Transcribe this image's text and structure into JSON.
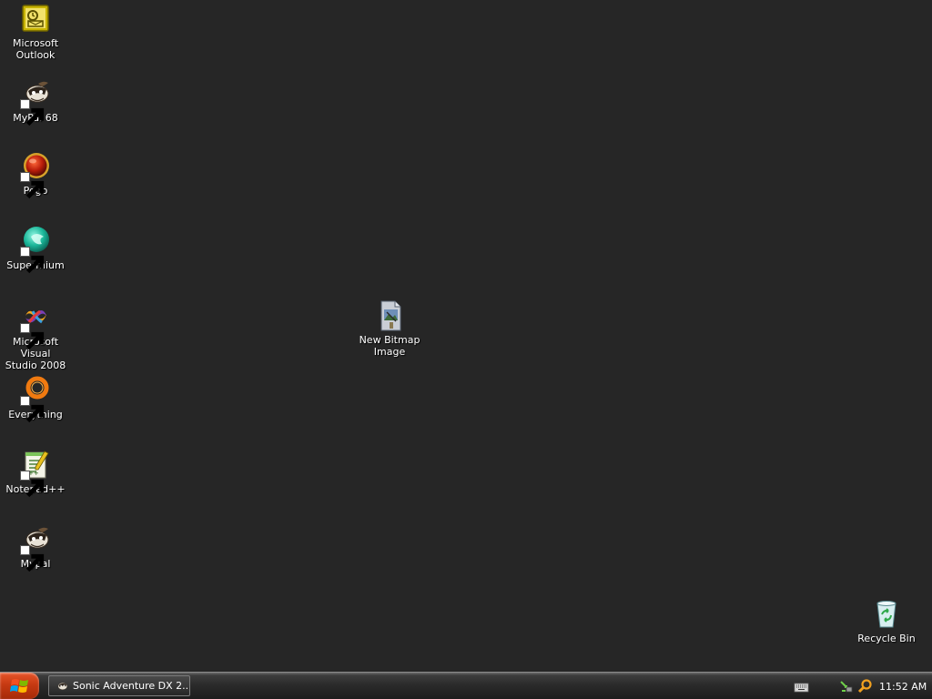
{
  "desktop": {
    "background_color": "#262626",
    "icons": [
      {
        "label": "Microsoft\nOutlook",
        "icon": "outlook-icon",
        "shortcut": false
      },
      {
        "label": "MyPal 68",
        "icon": "mypal-raccoon-icon",
        "shortcut": true
      },
      {
        "label": "Pego",
        "icon": "pego-icon",
        "shortcut": true
      },
      {
        "label": "Supermium",
        "icon": "supermium-icon",
        "shortcut": true
      },
      {
        "label": "Microsoft Visual\nStudio 2008",
        "icon": "visual-studio-icon",
        "shortcut": true
      },
      {
        "label": "Everything",
        "icon": "everything-icon",
        "shortcut": true
      },
      {
        "label": "Notepad++",
        "icon": "notepad-plus-plus-icon",
        "shortcut": true
      },
      {
        "label": "Mypal",
        "icon": "mypal-raccoon-icon",
        "shortcut": true
      },
      {
        "label": "New Bitmap\nImage",
        "icon": "bitmap-file-icon",
        "shortcut": false
      },
      {
        "label": "Recycle Bin",
        "icon": "recycle-bin-icon",
        "shortcut": false
      }
    ]
  },
  "taskbar": {
    "start_button": {
      "icon": "windows-logo-icon",
      "color": "#c63a12"
    },
    "task_button": {
      "label": "Sonic Adventure DX 2...",
      "icon": "mypal-raccoon-icon"
    },
    "language_bar": {
      "icon": "keyboard-icon"
    },
    "tray": {
      "icons": [
        "network-icon",
        "search-icon"
      ],
      "clock": "11:52 AM"
    }
  }
}
